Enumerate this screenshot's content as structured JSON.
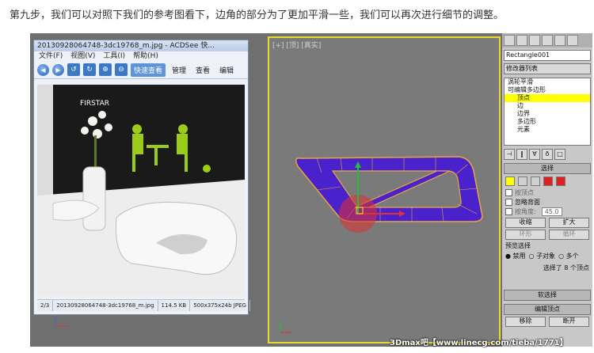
{
  "caption": "第九步，我们可以对照下我们的参考图看下，边角的部分为了更加平滑一些，我们可以再次进行细节的调整。",
  "acdsee": {
    "title": "20130928064748-3dc19768_m.jpg - ACDSee 快...",
    "menu": [
      "文件(F)",
      "视图(V)",
      "工具(I)",
      "帮助(H)"
    ],
    "toolbar": {
      "quick_view": "快速查看",
      "manage": "管理",
      "view": "查看",
      "edit": "编辑"
    },
    "photo_text": "FIRSTAR",
    "status": {
      "index": "2/3",
      "filename": "20130928064748-3dc19768_m.jpg",
      "size": "114.5 KB",
      "dims": "500x375x24b JPEG"
    }
  },
  "viewport": {
    "label": "[+] [顶] [真实]",
    "colors": {
      "shape": "#4a22cc",
      "shape_edge": "#e6a640",
      "gizmo_red": "#e03030",
      "gizmo_green": "#20c040"
    }
  },
  "panel": {
    "object_name": "Rectangle001",
    "modifier_list": "修改器列表",
    "stack": [
      {
        "label": "涡轮平滑",
        "selected": false
      },
      {
        "label": "可编辑多边形",
        "selected": false
      },
      {
        "label": "顶点",
        "selected": true
      },
      {
        "label": "边",
        "selected": false
      },
      {
        "label": "边界",
        "selected": false
      },
      {
        "label": "多边形",
        "selected": false
      },
      {
        "label": "元素",
        "selected": false
      }
    ],
    "selection_title": "选择",
    "by_vertex": "按顶点",
    "ignore_backface": "忽略背面",
    "by_angle": "按角度:",
    "angle_value": "45.0",
    "shrink": "收缩",
    "grow": "扩大",
    "ring": "环形",
    "loop": "循环",
    "preview_title": "预览选择",
    "disable": "禁用",
    "sub_object": "子对象",
    "multi": "多个",
    "selected_info": "选择了 8 个顶点",
    "soft_selection": "软选择",
    "edit_vertices": "编辑顶点",
    "remove": "移除",
    "break": "断开"
  },
  "watermark": "3Dmax吧【www.linecg.com/tieba/1771】"
}
